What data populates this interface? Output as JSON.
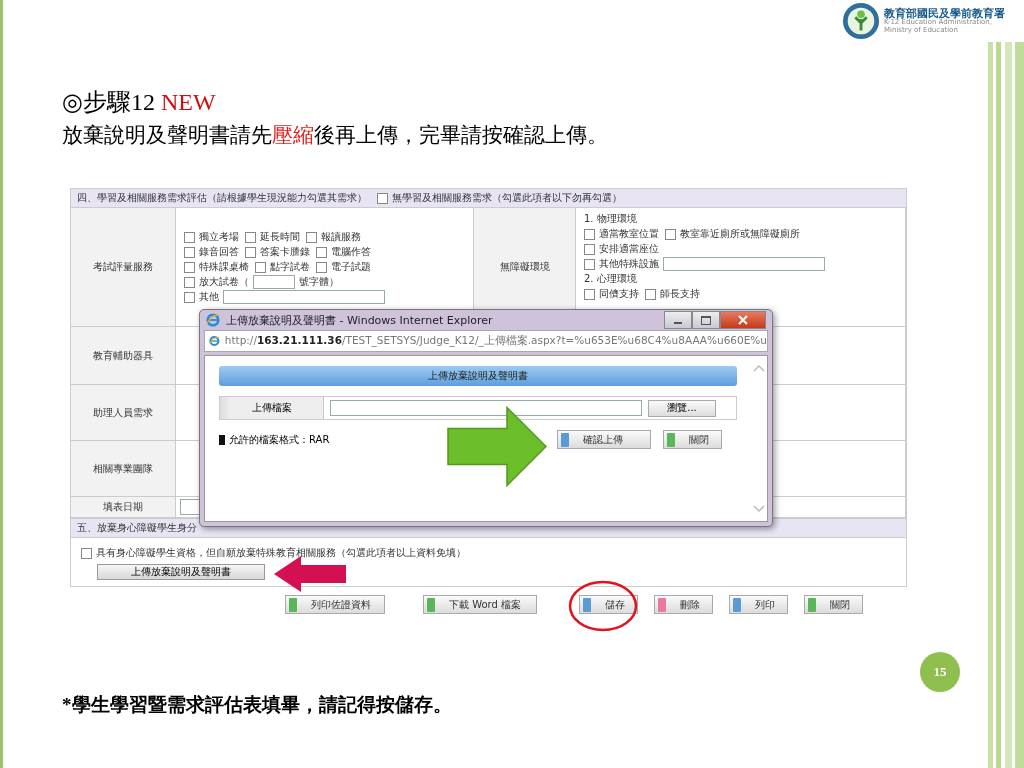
{
  "slide": {
    "title": "◎步驟12",
    "title_badge": "NEW",
    "subtitle": [
      {
        "text": "放棄說明及聲明書請先",
        "highlight": false
      },
      {
        "text": "壓縮",
        "highlight": true
      },
      {
        "text": "後再上傳，完畢請按確認上傳。",
        "highlight": false
      }
    ],
    "footnote": "*學生學習暨需求評估表填畢，請記得按儲存。",
    "page_number": "15"
  },
  "logo": {
    "name": "教育部國民及學前教育署",
    "english": [
      "K-12 Education Administration,",
      "Ministry of Education"
    ]
  },
  "form": {
    "section4_heading": "四、學習及相關服務需求評估（請根據學生現況能力勾選其需求）",
    "no_need": {
      "label": "無學習及相關服務需求（勾選此項者以下勿再勾選）",
      "checked": false
    },
    "exam": {
      "label": "考試評量服務",
      "rows": [
        [
          {
            "kind": "check",
            "label": "獨立考場",
            "checked": false
          },
          {
            "kind": "check",
            "label": "延長時間",
            "checked": false
          },
          {
            "kind": "check",
            "label": "報讀服務",
            "checked": false
          }
        ],
        [
          {
            "kind": "check",
            "label": "錄音回答",
            "checked": false
          },
          {
            "kind": "check",
            "label": "答案卡謄錄",
            "checked": false
          },
          {
            "kind": "check",
            "label": "電腦作答",
            "checked": false
          }
        ],
        [
          {
            "kind": "check",
            "label": "特殊課桌椅",
            "checked": false
          },
          {
            "kind": "check",
            "label": "點字試卷",
            "checked": false
          },
          {
            "kind": "check",
            "label": "電子試題",
            "checked": false
          }
        ],
        [
          {
            "kind": "size_field",
            "label": "放大試卷（",
            "suffix": "號字體）",
            "checked": false
          }
        ],
        [
          {
            "kind": "check_field",
            "label": "其他",
            "checked": false
          }
        ]
      ]
    },
    "environment": {
      "label": "無障礙環境",
      "groups": [
        {
          "heading": "1. 物理環境",
          "rows": [
            [
              {
                "kind": "check",
                "label": "適當教室位置",
                "checked": false
              },
              {
                "kind": "check",
                "label": "教室靠近廁所或無障礙廁所",
                "checked": false
              }
            ],
            [
              {
                "kind": "check",
                "label": "安排適當座位",
                "checked": false
              }
            ],
            [
              {
                "kind": "check_field",
                "label": "其他特殊設施",
                "checked": false
              }
            ]
          ]
        },
        {
          "heading": "2. 心理環境",
          "rows": [
            [
              {
                "kind": "check",
                "label": "同儕支持",
                "checked": false
              },
              {
                "kind": "check",
                "label": "師長支持",
                "checked": false
              }
            ]
          ]
        }
      ]
    },
    "other_rows": [
      "教育輔助器具",
      "助理人員需求",
      "相關專業團隊"
    ],
    "date_label": "填表日期",
    "section5_heading": "五、放棄身心障礙學生身分",
    "waive": {
      "label": "具有身心障礙學生資格，但自願放棄特殊教育相關服務（勾選此項者以上資料免填）",
      "checked": false
    },
    "upload_button": "上傳放棄說明及聲明書",
    "actions": [
      {
        "label": "列印佐證資料",
        "color": "#5bb55b",
        "highlighted": false
      },
      {
        "label": "下載 Word 檔案",
        "color": "#5bb55b",
        "highlighted": false
      },
      {
        "label": "儲存",
        "color": "#5b9bd5",
        "highlighted": true
      },
      {
        "label": "刪除",
        "color": "#e87aa0",
        "highlighted": false
      },
      {
        "label": "列印",
        "color": "#5b9bd5",
        "highlighted": false
      },
      {
        "label": "關閉",
        "color": "#5bb55b",
        "highlighted": false
      }
    ]
  },
  "popup": {
    "title": "上傳放棄說明及聲明書 - Windows Internet Explorer",
    "url": "http://**163.21.111.36**/TEST_SETSYS/Judge_K12/_上傳檔案.aspx?t=%u653E%u68C4%u8AAA%u660E%u",
    "header": "上傳放棄說明及聲明書",
    "field_label": "上傳檔案",
    "browse": "瀏覽...",
    "note": "允許的檔案格式：RAR",
    "buttons": [
      {
        "label": "確認上傳",
        "color": "#5b9bd5"
      },
      {
        "label": "關閉",
        "color": "#5bb55b"
      }
    ]
  }
}
